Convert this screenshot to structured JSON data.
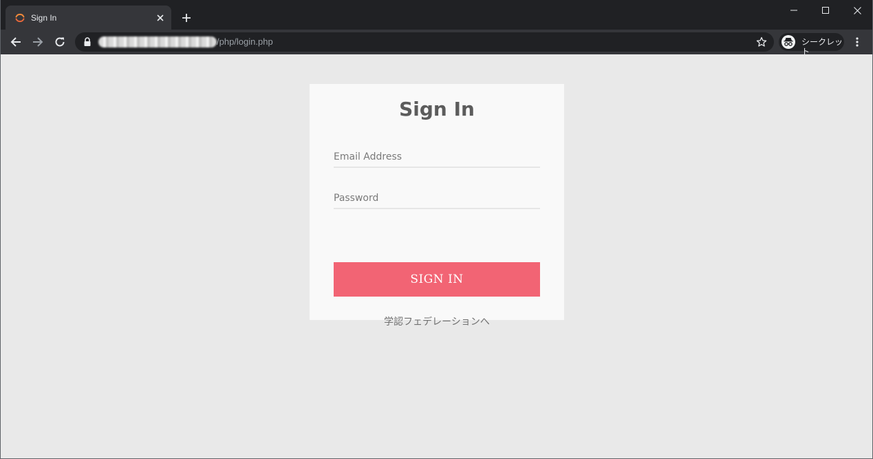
{
  "browser": {
    "tab": {
      "title": "Sign In"
    },
    "address_bar": {
      "url_path": "/php/login.php"
    },
    "incognito_label": "シークレット"
  },
  "login": {
    "title": "Sign In",
    "email_placeholder": "Email Address",
    "password_placeholder": "Password",
    "submit_label": "SIGN IN",
    "federation_link": "学認フェデレーションへ"
  },
  "colors": {
    "button": "#f26474",
    "card": "#f9f9f9",
    "page_background": "#e9e9e9",
    "title_text": "#5c5c5c"
  },
  "icons": [
    "app-favicon-icon",
    "close-icon",
    "plus-icon",
    "minimize-icon",
    "maximize-icon",
    "window-close-icon",
    "back-arrow-icon",
    "forward-arrow-icon",
    "reload-icon",
    "lock-icon",
    "star-icon",
    "incognito-icon",
    "more-vert-icon"
  ]
}
